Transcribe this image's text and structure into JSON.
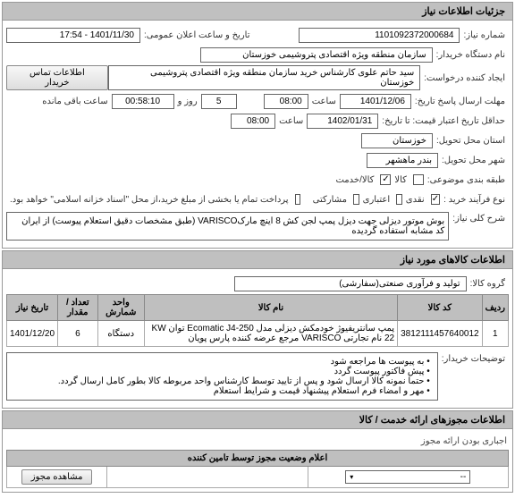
{
  "panels": {
    "need_info": "جزئیات اطلاعات نیاز",
    "goods_panel": "اطلاعات کالاهای مورد نیاز",
    "licenses_panel": "اطلاعات مجوزهای ارائه خدمت / کالا"
  },
  "info": {
    "need_no_label": "شماره نیاز:",
    "need_no": "1101092372000684",
    "announce_label": "تاریخ و ساعت اعلان عمومی:",
    "announce": "1401/11/30 - 17:54",
    "buyer_label": "نام دستگاه خریدار:",
    "buyer": "سازمان منطقه ویژه اقتصادی پتروشیمی خوزستان",
    "creator_label": "ایجاد کننده درخواست:",
    "creator": "سید حاتم علوی کارشناس خرید سازمان منطقه ویژه اقتصادی پتروشیمی خوزستان",
    "contact_btn": "اطلاعات تماس خریدار",
    "deadline_label": "مهلت ارسال پاسخ تاریخ:",
    "deadline_date": "1401/12/06",
    "time_label": "ساعت",
    "deadline_time": "08:00",
    "days": "5",
    "days_label": "روز و",
    "remain": "00:58:10",
    "remain_label": "ساعت باقی مانده",
    "validity_label": "حداقل تاریخ اعتبار قیمت:   تا تاریخ:",
    "validity_date": "1402/01/31",
    "validity_time": "08:00",
    "province_label": "استان محل تحویل:",
    "province": "خوزستان",
    "city_label": "شهر محل تحویل:",
    "city": "بندر ماهشهر",
    "supply_method_label": "طبقه بندی موضوعی:",
    "cb1": "کالا",
    "cb2": "کالا/خدمت",
    "buy_type_label": "نوع فرآیند خرید :",
    "bt1": "نقدی",
    "bt2": "اعتباری",
    "bt3": "مشارکتی",
    "note": "پرداخت تمام یا بخشی از مبلغ خرید،از محل \"اسناد خزانه اسلامی\" خواهد بود.",
    "note_cb": "",
    "desc_label": "شرح کلی نیاز:",
    "desc": "بوش موتور دیزلی جهت دیزل پمپ لجن کش 8 اینچ مارکVARISCO (طبق مشخصات دقیق استعلام پیوست) از ایران کد مشابه استفاده گردیده"
  },
  "goods": {
    "group_label": "گروه کالا:",
    "group_value": "تولید و فرآوری صنعتی(سفارشی)",
    "headers": [
      "ردیف",
      "کد کالا",
      "نام کالا",
      "واحد شمارش",
      "تعداد / مقدار",
      "تاریخ نیاز"
    ],
    "rows": [
      {
        "r": "1",
        "code": "3812111457640012",
        "name": "پمپ سانتریفیوژ خودمکش دیزلی مدل Ecomatic J4-250 توان KW 22 نام تجارتی VARISCO مرجع عرضه کننده پارس پویان",
        "unit": "دستگاه",
        "qty": "6",
        "date": "1401/12/20"
      }
    ],
    "buyer_notes_label": "توضیحات خریدار:",
    "bullets": [
      "به پیوست ها مراجعه شود",
      "پیش فاکتور پیوست گردد",
      "حتما نمونه کالا ارسال شود و پس از تایید توسط کارشناس واحد مربوطه کالا بطور کامل ارسال گردد.",
      "مهر و امضاء فرم استعلام پیشنهاد قیمت و شرایط استعلام"
    ]
  },
  "lic": {
    "mandatory_label": "اجباری بودن ارائه مجوز",
    "status_header": "اعلام وضعیت مجوز توسط تامین کننده",
    "select_placeholder": "--",
    "view_btn": "مشاهده مجوز"
  }
}
